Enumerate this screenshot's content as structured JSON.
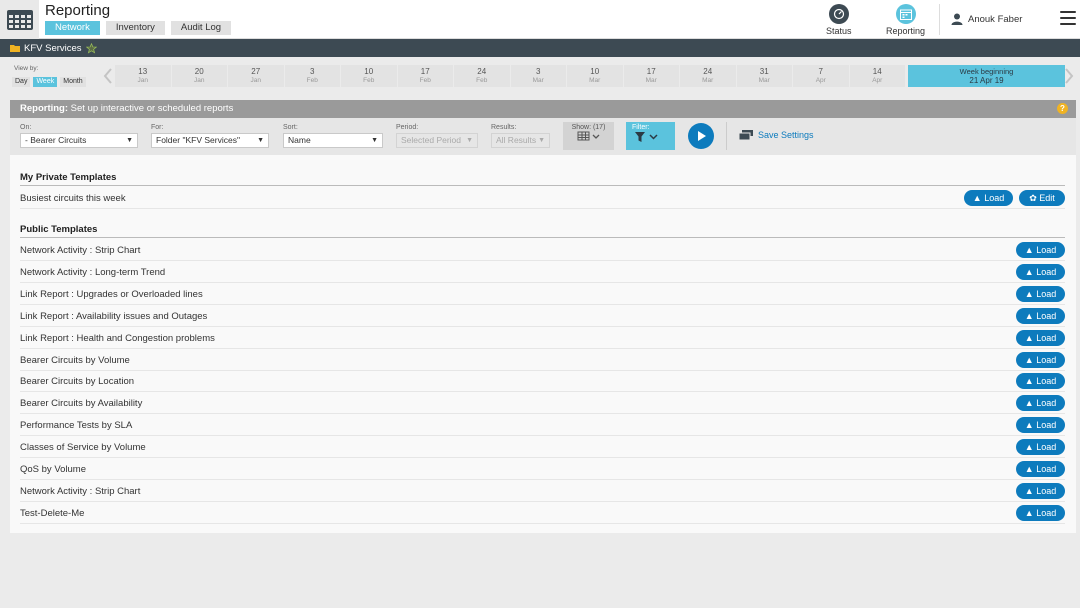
{
  "app": {
    "title": "Reporting",
    "tabs": [
      {
        "label": "Network",
        "active": true
      },
      {
        "label": "Inventory",
        "active": false
      },
      {
        "label": "Audit Log",
        "active": false
      }
    ],
    "status_label": "Status",
    "reporting_label": "Reporting",
    "user_name": "Anouk Faber"
  },
  "context": {
    "folder_name": "KFV Services"
  },
  "timeline": {
    "view_by_label": "View by:",
    "view_options": [
      "Day",
      "Week",
      "Month"
    ],
    "active_view": "Week",
    "weeks": [
      {
        "day": "13",
        "month": "Jan"
      },
      {
        "day": "20",
        "month": "Jan"
      },
      {
        "day": "27",
        "month": "Jan"
      },
      {
        "day": "3",
        "month": "Feb"
      },
      {
        "day": "10",
        "month": "Feb"
      },
      {
        "day": "17",
        "month": "Feb"
      },
      {
        "day": "24",
        "month": "Feb"
      },
      {
        "day": "3",
        "month": "Mar"
      },
      {
        "day": "10",
        "month": "Mar"
      },
      {
        "day": "17",
        "month": "Mar"
      },
      {
        "day": "24",
        "month": "Mar"
      },
      {
        "day": "31",
        "month": "Mar"
      },
      {
        "day": "7",
        "month": "Apr"
      },
      {
        "day": "14",
        "month": "Apr"
      }
    ],
    "current_week_label": "Week beginning",
    "current_week_date": "21 Apr 19"
  },
  "panel": {
    "heading_bold": "Reporting:",
    "heading_text": "Set up interactive or scheduled reports",
    "help_glyph": "?",
    "controls": {
      "on_label": "On:",
      "on_value": "- Bearer Circuits",
      "for_label": "For:",
      "for_value": "Folder \"KFV Services\"",
      "sort_label": "Sort:",
      "sort_value": "Name",
      "period_label": "Period:",
      "period_placeholder": "Selected Period",
      "results_label": "Results:",
      "results_placeholder": "All Results",
      "show_label": "Show: (17)",
      "filter_label": "Filter:",
      "save_label": "Save Settings"
    },
    "private_title": "My Private Templates",
    "private_templates": [
      {
        "name": "Busiest circuits this week"
      }
    ],
    "public_title": "Public Templates",
    "public_templates": [
      {
        "name": "Network Activity : Strip Chart"
      },
      {
        "name": "Network Activity : Long-term Trend"
      },
      {
        "name": "Link Report : Upgrades or Overloaded lines"
      },
      {
        "name": "Link Report : Availability issues and Outages"
      },
      {
        "name": "Link Report : Health and Congestion problems"
      },
      {
        "name": "Bearer Circuits by Volume"
      },
      {
        "name": "Bearer Circuits by Location"
      },
      {
        "name": "Bearer Circuits by Availability"
      },
      {
        "name": "Performance Tests by SLA"
      },
      {
        "name": "Classes of Service by Volume"
      },
      {
        "name": "QoS by Volume"
      },
      {
        "name": "Network Activity : Strip Chart"
      },
      {
        "name": "Test-Delete-Me"
      }
    ],
    "load_label": "▲ Load",
    "edit_label": "✿ Edit"
  },
  "colors": {
    "accent": "#5bc3dd",
    "primary_button": "#0d7bbd",
    "dark_strip": "#3d4a53"
  }
}
